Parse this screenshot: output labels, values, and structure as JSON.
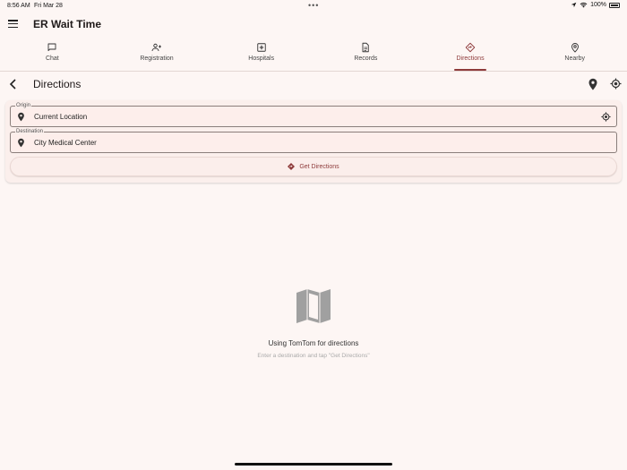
{
  "status_bar": {
    "time": "8:56 AM",
    "date": "Fri Mar 28",
    "dots": "•••",
    "battery": "100%"
  },
  "app": {
    "title": "ER Wait Time"
  },
  "tabs": [
    {
      "label": "Chat",
      "icon": "chat-icon"
    },
    {
      "label": "Registration",
      "icon": "person-add-icon"
    },
    {
      "label": "Hospitals",
      "icon": "hospital-icon"
    },
    {
      "label": "Records",
      "icon": "document-icon"
    },
    {
      "label": "Directions",
      "icon": "directions-icon",
      "active": true
    },
    {
      "label": "Nearby",
      "icon": "location-pin-icon"
    }
  ],
  "header": {
    "title": "Directions"
  },
  "form": {
    "origin": {
      "label": "Origin",
      "value": "Current Location"
    },
    "destination": {
      "label": "Destination",
      "value": "City Medical Center"
    },
    "submit_label": "Get Directions"
  },
  "empty_state": {
    "title": "Using TomTom for directions",
    "subtitle": "Enter a destination and tap \"Get Directions\""
  },
  "colors": {
    "accent": "#8e3b3b",
    "background": "#fdf6f4"
  }
}
